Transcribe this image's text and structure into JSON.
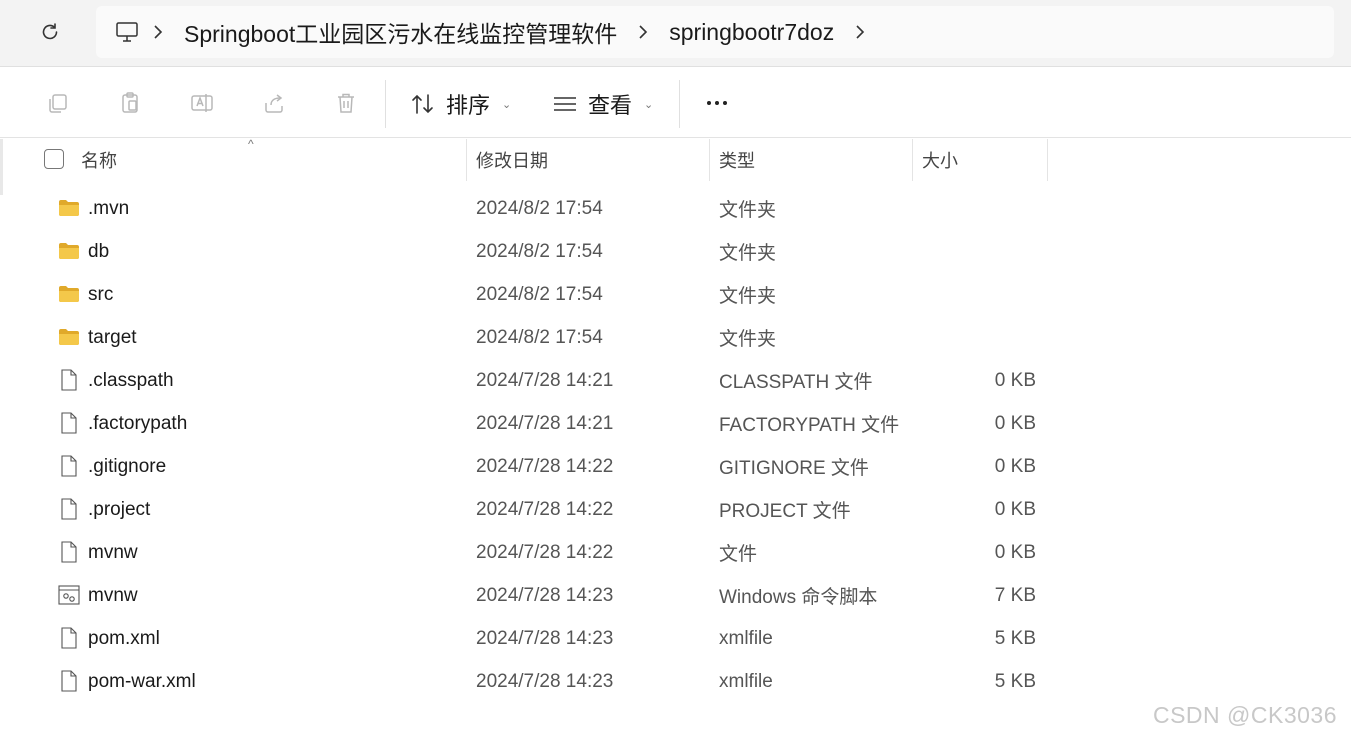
{
  "breadcrumb": {
    "items": [
      {
        "label": "Springboot工业园区污水在线监控管理软件"
      },
      {
        "label": "springbootr7doz"
      }
    ]
  },
  "toolbar": {
    "sort_label": "排序",
    "view_label": "查看"
  },
  "columns": {
    "name": "名称",
    "modified": "修改日期",
    "type": "类型",
    "size": "大小"
  },
  "files": [
    {
      "icon": "folder-icon",
      "name": ".mvn",
      "modified": "2024/8/2 17:54",
      "type": "文件夹",
      "size": ""
    },
    {
      "icon": "folder-icon",
      "name": "db",
      "modified": "2024/8/2 17:54",
      "type": "文件夹",
      "size": ""
    },
    {
      "icon": "folder-icon",
      "name": "src",
      "modified": "2024/8/2 17:54",
      "type": "文件夹",
      "size": ""
    },
    {
      "icon": "folder-icon",
      "name": "target",
      "modified": "2024/8/2 17:54",
      "type": "文件夹",
      "size": ""
    },
    {
      "icon": "file-icon",
      "name": ".classpath",
      "modified": "2024/7/28 14:21",
      "type": "CLASSPATH 文件",
      "size": "0 KB"
    },
    {
      "icon": "file-icon",
      "name": ".factorypath",
      "modified": "2024/7/28 14:21",
      "type": "FACTORYPATH 文件",
      "size": "0 KB"
    },
    {
      "icon": "file-icon",
      "name": ".gitignore",
      "modified": "2024/7/28 14:22",
      "type": "GITIGNORE 文件",
      "size": "0 KB"
    },
    {
      "icon": "file-icon",
      "name": ".project",
      "modified": "2024/7/28 14:22",
      "type": "PROJECT 文件",
      "size": "0 KB"
    },
    {
      "icon": "file-icon",
      "name": "mvnw",
      "modified": "2024/7/28 14:22",
      "type": "文件",
      "size": "0 KB"
    },
    {
      "icon": "script-icon",
      "name": "mvnw",
      "modified": "2024/7/28 14:23",
      "type": "Windows 命令脚本",
      "size": "7 KB"
    },
    {
      "icon": "file-icon",
      "name": "pom.xml",
      "modified": "2024/7/28 14:23",
      "type": "xmlfile",
      "size": "5 KB"
    },
    {
      "icon": "file-icon",
      "name": "pom-war.xml",
      "modified": "2024/7/28 14:23",
      "type": "xmlfile",
      "size": "5 KB"
    }
  ],
  "watermark": "CSDN @CK3036",
  "colors": {
    "folder": "#f4c84a",
    "folder_dark": "#e0a92a",
    "toolbar_icon_disabled": "#b8b8b8"
  }
}
